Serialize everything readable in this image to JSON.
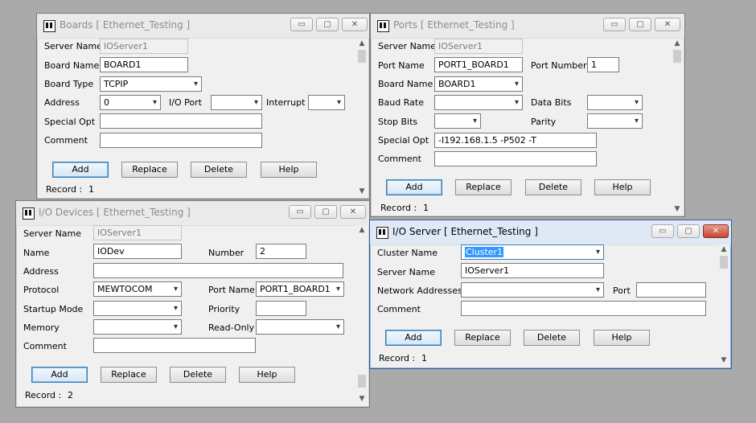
{
  "boards": {
    "title": "Boards [ Ethernet_Testing ]",
    "server_name_label": "Server Name",
    "server_name": "IOServer1",
    "board_name_label": "Board Name",
    "board_name": "BOARD1",
    "board_type_label": "Board Type",
    "board_type": "TCPIP",
    "address_label": "Address",
    "address": "0",
    "io_port_label": "I/O Port",
    "io_port": "",
    "interrupt_label": "Interrupt",
    "interrupt": "",
    "special_opt_label": "Special Opt",
    "special_opt": "",
    "comment_label": "Comment",
    "comment": "",
    "add": "Add",
    "replace": "Replace",
    "delete": "Delete",
    "help": "Help",
    "record_label": "Record :",
    "record": "1"
  },
  "ports": {
    "title": "Ports [ Ethernet_Testing ]",
    "server_name_label": "Server Name",
    "server_name": "IOServer1",
    "port_name_label": "Port Name",
    "port_name": "PORT1_BOARD1",
    "port_number_label": "Port Number",
    "port_number": "1",
    "board_name_label": "Board Name",
    "board_name": "BOARD1",
    "baud_rate_label": "Baud Rate",
    "baud_rate": "",
    "data_bits_label": "Data Bits",
    "data_bits": "",
    "stop_bits_label": "Stop Bits",
    "stop_bits": "",
    "parity_label": "Parity",
    "parity": "",
    "special_opt_label": "Special Opt",
    "special_opt": "-I192.168.1.5 -P502 -T",
    "comment_label": "Comment",
    "comment": "",
    "add": "Add",
    "replace": "Replace",
    "delete": "Delete",
    "help": "Help",
    "record_label": "Record :",
    "record": "1"
  },
  "io_devices": {
    "title": "I/O Devices [ Ethernet_Testing ]",
    "server_name_label": "Server Name",
    "server_name": "IOServer1",
    "name_label": "Name",
    "name": "IODev",
    "number_label": "Number",
    "number": "2",
    "address_label": "Address",
    "address": "",
    "protocol_label": "Protocol",
    "protocol": "MEWTOCOM",
    "port_name_label": "Port Name",
    "port_name": "PORT1_BOARD1",
    "startup_mode_label": "Startup Mode",
    "startup_mode": "",
    "priority_label": "Priority",
    "priority": "",
    "memory_label": "Memory",
    "memory": "",
    "read_only_label": "Read-Only",
    "read_only": "",
    "comment_label": "Comment",
    "comment": "",
    "add": "Add",
    "replace": "Replace",
    "delete": "Delete",
    "help": "Help",
    "record_label": "Record :",
    "record": "2"
  },
  "io_server": {
    "title": "I/O Server [ Ethernet_Testing ]",
    "cluster_name_label": "Cluster Name",
    "cluster_name": "Cluster1",
    "server_name_label": "Server Name",
    "server_name": "IOServer1",
    "network_addresses_label": "Network Addresses",
    "network_addresses": "",
    "port_label": "Port",
    "port": "",
    "comment_label": "Comment",
    "comment": "",
    "add": "Add",
    "replace": "Replace",
    "delete": "Delete",
    "help": "Help",
    "record_label": "Record :",
    "record": "1"
  },
  "titlebar_buttons": {
    "minimize": "▭",
    "maximize": "▢",
    "close": "✕"
  },
  "icons": {
    "dropdown": "▾",
    "scroll_up": "▲",
    "scroll_down": "▼"
  },
  "colors": {
    "desktop": "#aaaaaa",
    "window": "#f0f0f0",
    "selection": "#3399ff",
    "close_active": "#c5452e"
  }
}
